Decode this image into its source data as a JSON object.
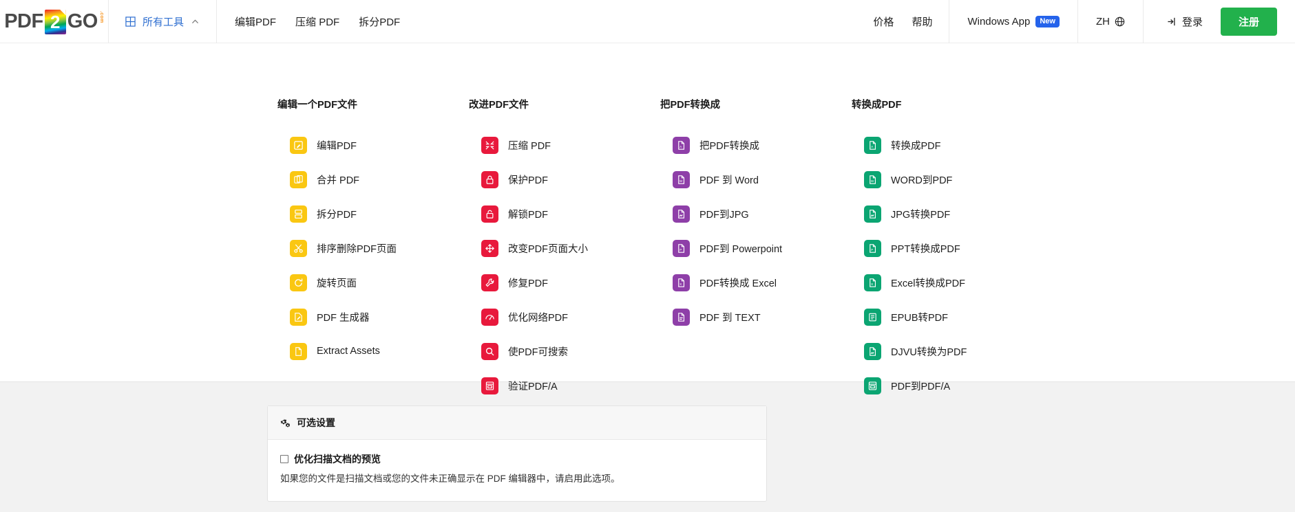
{
  "header": {
    "logo": {
      "left_text": "PDF",
      "square_text": "2",
      "right_text": "GO",
      "suffix": ".com"
    },
    "all_tools": {
      "label": "所有工具",
      "grid_icon": "grid-icon",
      "chevron_icon": "chevron-up-icon"
    },
    "nav_links": [
      {
        "label": "编辑PDF"
      },
      {
        "label": "压缩 PDF"
      },
      {
        "label": "拆分PDF"
      }
    ],
    "right_links": [
      {
        "label": "价格"
      },
      {
        "label": "帮助"
      }
    ],
    "windows_app": {
      "label": "Windows App",
      "badge": "New",
      "badge_color": "#2563EB"
    },
    "language": {
      "label": "ZH",
      "icon": "globe-icon"
    },
    "login": {
      "label": "登录",
      "icon": "login-arrow-icon"
    },
    "signup": {
      "label": "注册",
      "color": "#22B14C"
    }
  },
  "megamenu": {
    "columns": [
      {
        "heading": "编辑一个PDF文件",
        "color": "#FAC712",
        "items": [
          {
            "label": "编辑PDF",
            "icon": "edit-pdf-icon"
          },
          {
            "label": "合并 PDF",
            "icon": "merge-pdf-icon"
          },
          {
            "label": "拆分PDF",
            "icon": "split-pdf-icon"
          },
          {
            "label": "排序删除PDF页面",
            "icon": "scissors-icon"
          },
          {
            "label": "旋转页面",
            "icon": "rotate-icon"
          },
          {
            "label": "PDF 生成器",
            "icon": "pdf-creator-icon"
          },
          {
            "label": "Extract Assets",
            "icon": "extract-assets-icon"
          }
        ]
      },
      {
        "heading": "改进PDF文件",
        "color": "#E8193C",
        "items": [
          {
            "label": "压缩 PDF",
            "icon": "compress-icon"
          },
          {
            "label": "保护PDF",
            "icon": "lock-closed-icon"
          },
          {
            "label": "解锁PDF",
            "icon": "lock-open-icon"
          },
          {
            "label": "改变PDF页面大小",
            "icon": "resize-arrows-icon"
          },
          {
            "label": "修复PDF",
            "icon": "wrench-icon"
          },
          {
            "label": "优化网络PDF",
            "icon": "web-optimize-icon"
          },
          {
            "label": "使PDF可搜索",
            "icon": "search-icon"
          },
          {
            "label": "验证PDF/A",
            "icon": "validate-icon"
          }
        ]
      },
      {
        "heading": "把PDF转换成",
        "color": "#8E3FA8",
        "items": [
          {
            "label": "把PDF转换成",
            "icon": "convert-from-pdf-icon"
          },
          {
            "label": "PDF 到 Word",
            "icon": "pdf-to-word-icon"
          },
          {
            "label": "PDF到JPG",
            "icon": "pdf-to-jpg-icon"
          },
          {
            "label": "PDF到 Powerpoint",
            "icon": "pdf-to-ppt-icon"
          },
          {
            "label": "PDF转换成 Excel",
            "icon": "pdf-to-excel-icon"
          },
          {
            "label": "PDF 到 TEXT",
            "icon": "pdf-to-text-icon"
          }
        ]
      },
      {
        "heading": "转换成PDF",
        "color": "#0BA572",
        "items": [
          {
            "label": "转换成PDF",
            "icon": "convert-to-pdf-icon"
          },
          {
            "label": "WORD到PDF",
            "icon": "word-to-pdf-icon"
          },
          {
            "label": "JPG转换PDF",
            "icon": "jpg-to-pdf-icon"
          },
          {
            "label": "PPT转换成PDF",
            "icon": "ppt-to-pdf-icon"
          },
          {
            "label": "Excel转换成PDF",
            "icon": "excel-to-pdf-icon"
          },
          {
            "label": "EPUB转PDF",
            "icon": "epub-to-pdf-icon"
          },
          {
            "label": "DJVU转换为PDF",
            "icon": "djvu-to-pdf-icon"
          },
          {
            "label": "PDF到PDF/A",
            "icon": "pdf-to-pdfa-icon"
          }
        ]
      }
    ]
  },
  "settings": {
    "heading": "可选设置",
    "heading_icon": "gears-icon",
    "option": {
      "label": "优化扫描文档的预览",
      "description": "如果您的文件是扫描文档或您的文件未正确显示在 PDF 编辑器中，请启用此选项。",
      "checked": false
    }
  }
}
